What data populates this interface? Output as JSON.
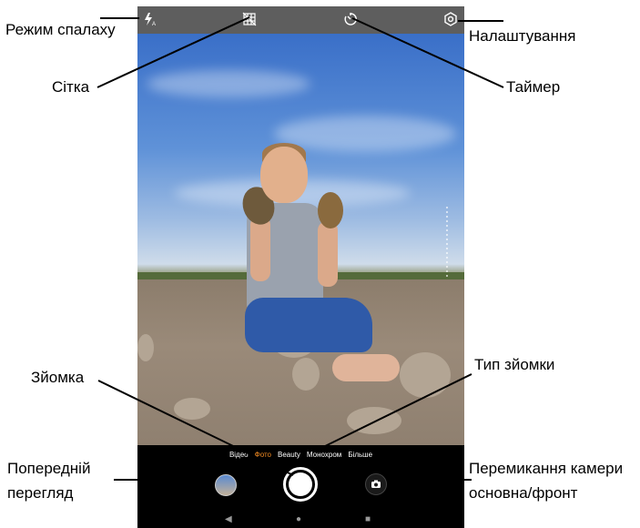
{
  "camera": {
    "modes": [
      "Відео",
      "Фото",
      "Beauty",
      "Монохром",
      "Більше"
    ],
    "active_mode": "Фото",
    "accent_color": "#f08a22",
    "top_icons": [
      "flash-auto-icon",
      "grid-off-icon",
      "timer-icon",
      "settings-gear-icon"
    ],
    "bottom_icons": [
      "gallery-thumbnail",
      "shutter-button-icon",
      "camera-switch-icon"
    ],
    "nav_icons": [
      "back-triangle-icon",
      "home-circle-icon",
      "recents-square-icon"
    ]
  },
  "annotations": {
    "flash_mode": "Режим спалаху",
    "grid": "Сітка",
    "settings": "Налаштування",
    "timer": "Таймер",
    "capture": "Зйомка",
    "capture_type": "Тип зйомки",
    "preview_line1": "Попередній",
    "preview_line2": "перегляд",
    "switch_line1": "Перемикання камери",
    "switch_line2": "основна/фронт"
  },
  "nav": {
    "back": "◀",
    "home": "●",
    "recents": "■"
  }
}
